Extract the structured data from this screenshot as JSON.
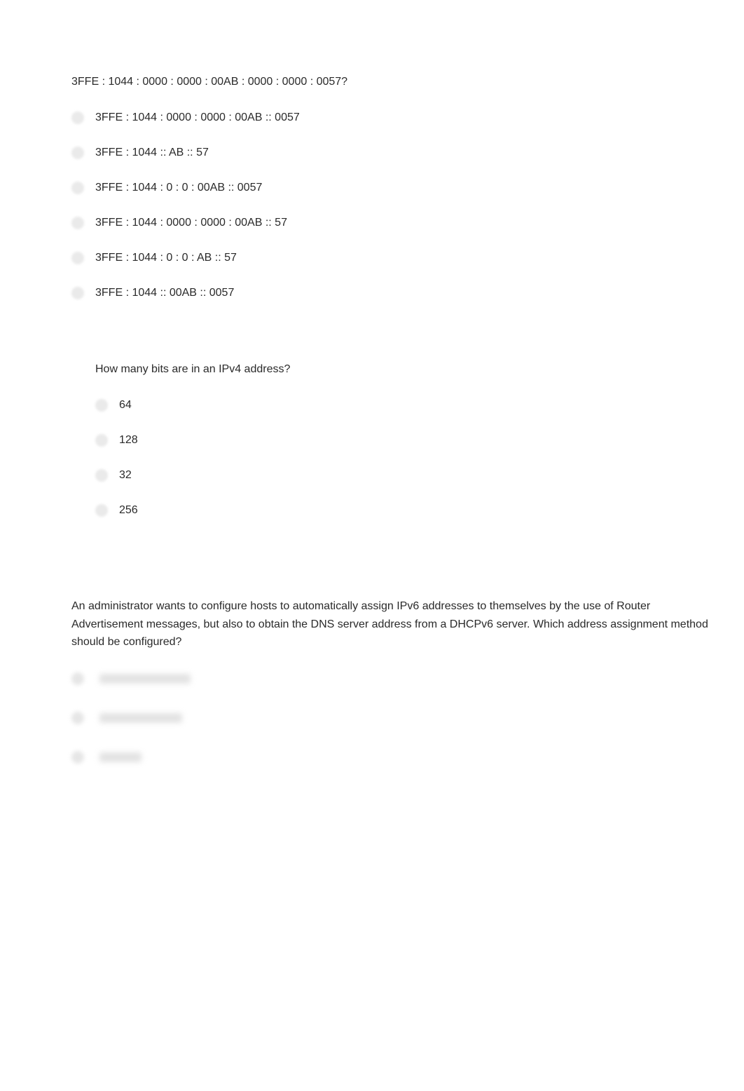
{
  "questions": [
    {
      "text": "3FFE : 1044 : 0000 : 0000 : 00AB : 0000 : 0000 : 0057?",
      "options": [
        "3FFE : 1044 : 0000 : 0000 : 00AB :: 0057",
        "3FFE : 1044 :: AB :: 57",
        "3FFE : 1044 : 0 : 0 : 00AB :: 0057",
        "3FFE : 1044 : 0000 : 0000 : 00AB :: 57",
        "3FFE : 1044 : 0 : 0 : AB :: 57",
        "3FFE : 1044 :: 00AB :: 0057"
      ]
    },
    {
      "text": "How many bits are in an IPv4 address?",
      "options": [
        "64",
        "128",
        "32",
        "256"
      ]
    },
    {
      "text": "An administrator wants to configure hosts to automatically assign IPv6 addresses to themselves by the use of Router Advertisement messages, but also to obtain the DNS server address from a DHCPv6 server. Which address assignment method should be configured?"
    }
  ]
}
